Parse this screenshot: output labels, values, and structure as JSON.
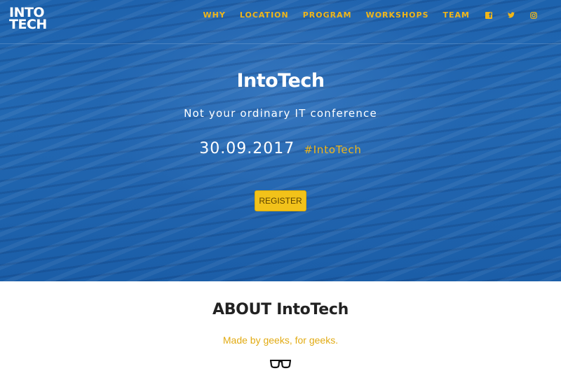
{
  "brand": {
    "line1": "INTO",
    "line2": "TECH"
  },
  "nav": {
    "items": [
      {
        "label": "WHY"
      },
      {
        "label": "LOCATION"
      },
      {
        "label": "PROGRAM"
      },
      {
        "label": "WORKSHOPS"
      },
      {
        "label": "TEAM"
      }
    ],
    "social_icons": [
      "facebook-icon",
      "twitter-icon",
      "instagram-icon"
    ]
  },
  "hero": {
    "title": "IntoTech",
    "subtitle": "Not your ordinary IT conference",
    "date": "30.09.2017",
    "hashtag": "#IntoTech",
    "register_label": "REGISTER"
  },
  "about": {
    "title": "ABOUT IntoTech",
    "subtitle": "Made by geeks, for geeks.",
    "icon": "glasses-icon"
  },
  "colors": {
    "hero_blue": "#1d63ae",
    "accent_yellow": "#f0b619",
    "button_yellow": "#f2c21a",
    "text_dark": "#222222"
  }
}
